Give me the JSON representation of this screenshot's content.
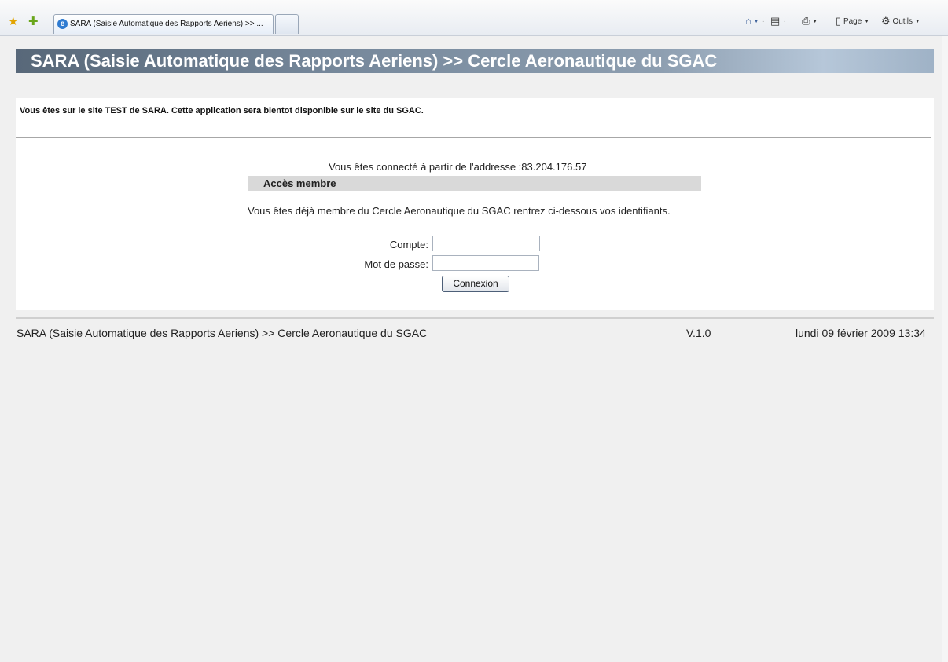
{
  "browser": {
    "tab_title": "SARA (Saisie Automatique des Rapports Aeriens) >> ...",
    "commands": {
      "page_label": "Page",
      "tools_label": "Outils"
    }
  },
  "header": {
    "title": "SARA (Saisie Automatique des Rapports Aeriens) >> Cercle Aeronautique du SGAC"
  },
  "notice": "Vous êtes sur le site TEST de SARA. Cette application sera bientot disponible sur le site du SGAC.",
  "login": {
    "ip_line": "Vous êtes connecté à partir de l'addresse :83.204.176.57",
    "section_title": "Accès membre",
    "intro": "Vous êtes déjà membre du Cercle Aeronautique du SGAC rentrez ci-dessous vos identifiants.",
    "account_label": "Compte:",
    "password_label": "Mot de passe:",
    "account_value": "",
    "password_value": "",
    "submit_label": "Connexion"
  },
  "footer": {
    "title": "SARA (Saisie Automatique des Rapports Aeriens) >> Cercle Aeronautique du SGAC",
    "version": "V.1.0",
    "date": "lundi 09 février 2009 13:34"
  },
  "colors": {
    "header_start": "#586879",
    "header_end": "#b6c7d9",
    "section_bar": "#d9d9d9",
    "page_background": "#f0f0f0"
  },
  "icons": [
    "favorites-star-icon",
    "add-favorite-icon",
    "ie-page-icon",
    "home-icon",
    "feeds-icon",
    "print-icon",
    "page-icon",
    "tools-gear-icon"
  ]
}
